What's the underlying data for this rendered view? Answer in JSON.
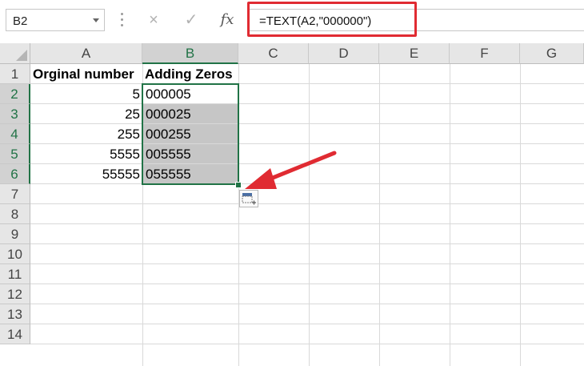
{
  "name_box": {
    "value": "B2"
  },
  "formula_bar": {
    "cancel_icon": "×",
    "enter_icon": "✓",
    "function_icon": "fx",
    "formula": "=TEXT(A2,\"000000\")"
  },
  "columns": [
    "A",
    "B",
    "C",
    "D",
    "E",
    "F",
    "G"
  ],
  "rows": [
    "1",
    "2",
    "3",
    "4",
    "5",
    "6",
    "7",
    "8",
    "9",
    "10",
    "11",
    "12",
    "13",
    "14"
  ],
  "sheet": {
    "a1": "Orginal number",
    "b1": "Adding Zeros",
    "a2": "5",
    "b2": "000005",
    "a3": "25",
    "b3": "000025",
    "a4": "255",
    "b4": "000255",
    "a5": "5555",
    "b5": "005555",
    "a6": "55555",
    "b6": "055555"
  },
  "colors": {
    "selection": "#217346",
    "highlight": "#e02b32",
    "shaded_cell": "#c6c6c6"
  },
  "icons": {
    "paste_options": "paste-options-icon",
    "annotation_arrow": "red-arrow"
  }
}
